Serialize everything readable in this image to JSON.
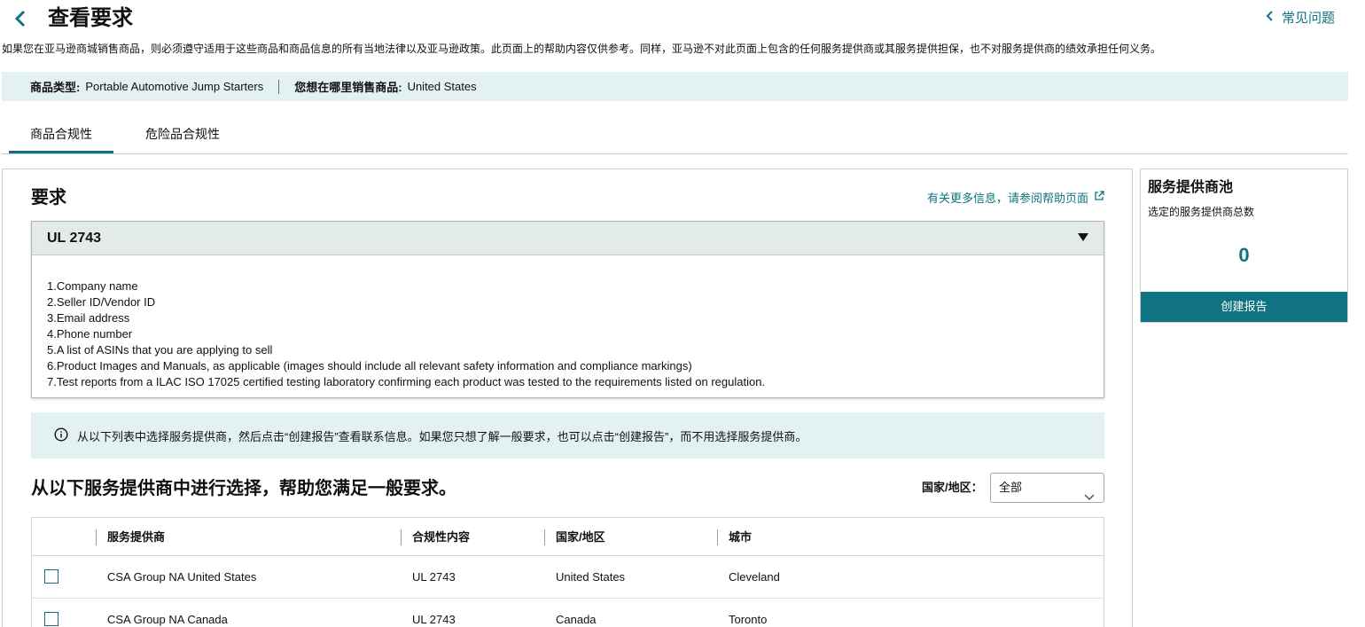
{
  "header": {
    "title": "查看要求",
    "faq_label": "常见问题"
  },
  "disclaimer": "如果您在亚马逊商城销售商品，则必须遵守适用于这些商品和商品信息的所有当地法律以及亚马逊政策。此页面上的帮助内容仅供参考。同样，亚马逊不对此页面上包含的任何服务提供商或其服务提供担保，也不对服务提供商的绩效承担任何义务。",
  "info_bar": {
    "product_type_label": "商品类型:",
    "product_type_value": "Portable Automotive Jump Starters",
    "where_label": "您想在哪里销售商品:",
    "where_value": "United States"
  },
  "tabs": [
    {
      "label": "商品合规性",
      "active": true
    },
    {
      "label": "危险品合规性",
      "active": false
    }
  ],
  "requirements": {
    "title": "要求",
    "help_link": "有关更多信息，请参阅帮助页面",
    "accordion_title": "UL 2743",
    "items": [
      "1.Company name",
      "2.Seller ID/Vendor ID",
      "3.Email address",
      "4.Phone number",
      "5.A list of ASINs that you are applying to sell",
      "6.Product Images and Manuals, as applicable (images should include all relevant safety information and compliance markings)",
      "7.Test reports from a ILAC ISO 17025 certified testing laboratory confirming each product was tested to the requirements listed on regulation."
    ]
  },
  "notice": "从以下列表中选择服务提供商，然后点击“创建报告”查看联系信息。如果您只想了解一般要求，也可以点击“创建报告”，而不用选择服务提供商。",
  "providers": {
    "heading": "从以下服务提供商中进行选择，帮助您满足一般要求。",
    "country_filter_label": "国家/地区：",
    "country_filter_value": "全部",
    "columns": [
      "服务提供商",
      "合规性内容",
      "国家/地区",
      "城市"
    ],
    "rows": [
      {
        "name": "CSA Group NA United States",
        "compliance": "UL 2743",
        "country": "United States",
        "city": "Cleveland"
      },
      {
        "name": "CSA Group NA Canada",
        "compliance": "UL 2743",
        "country": "Canada",
        "city": "Toronto"
      }
    ]
  },
  "pool": {
    "title": "服务提供商池",
    "subtitle": "选定的服务提供商总数",
    "count": "0",
    "create_report": "创建报告"
  },
  "colors": {
    "accent": "#0f7381",
    "info_bg": "#e3f1f1",
    "accordion_header_bg": "#e3eaea"
  }
}
